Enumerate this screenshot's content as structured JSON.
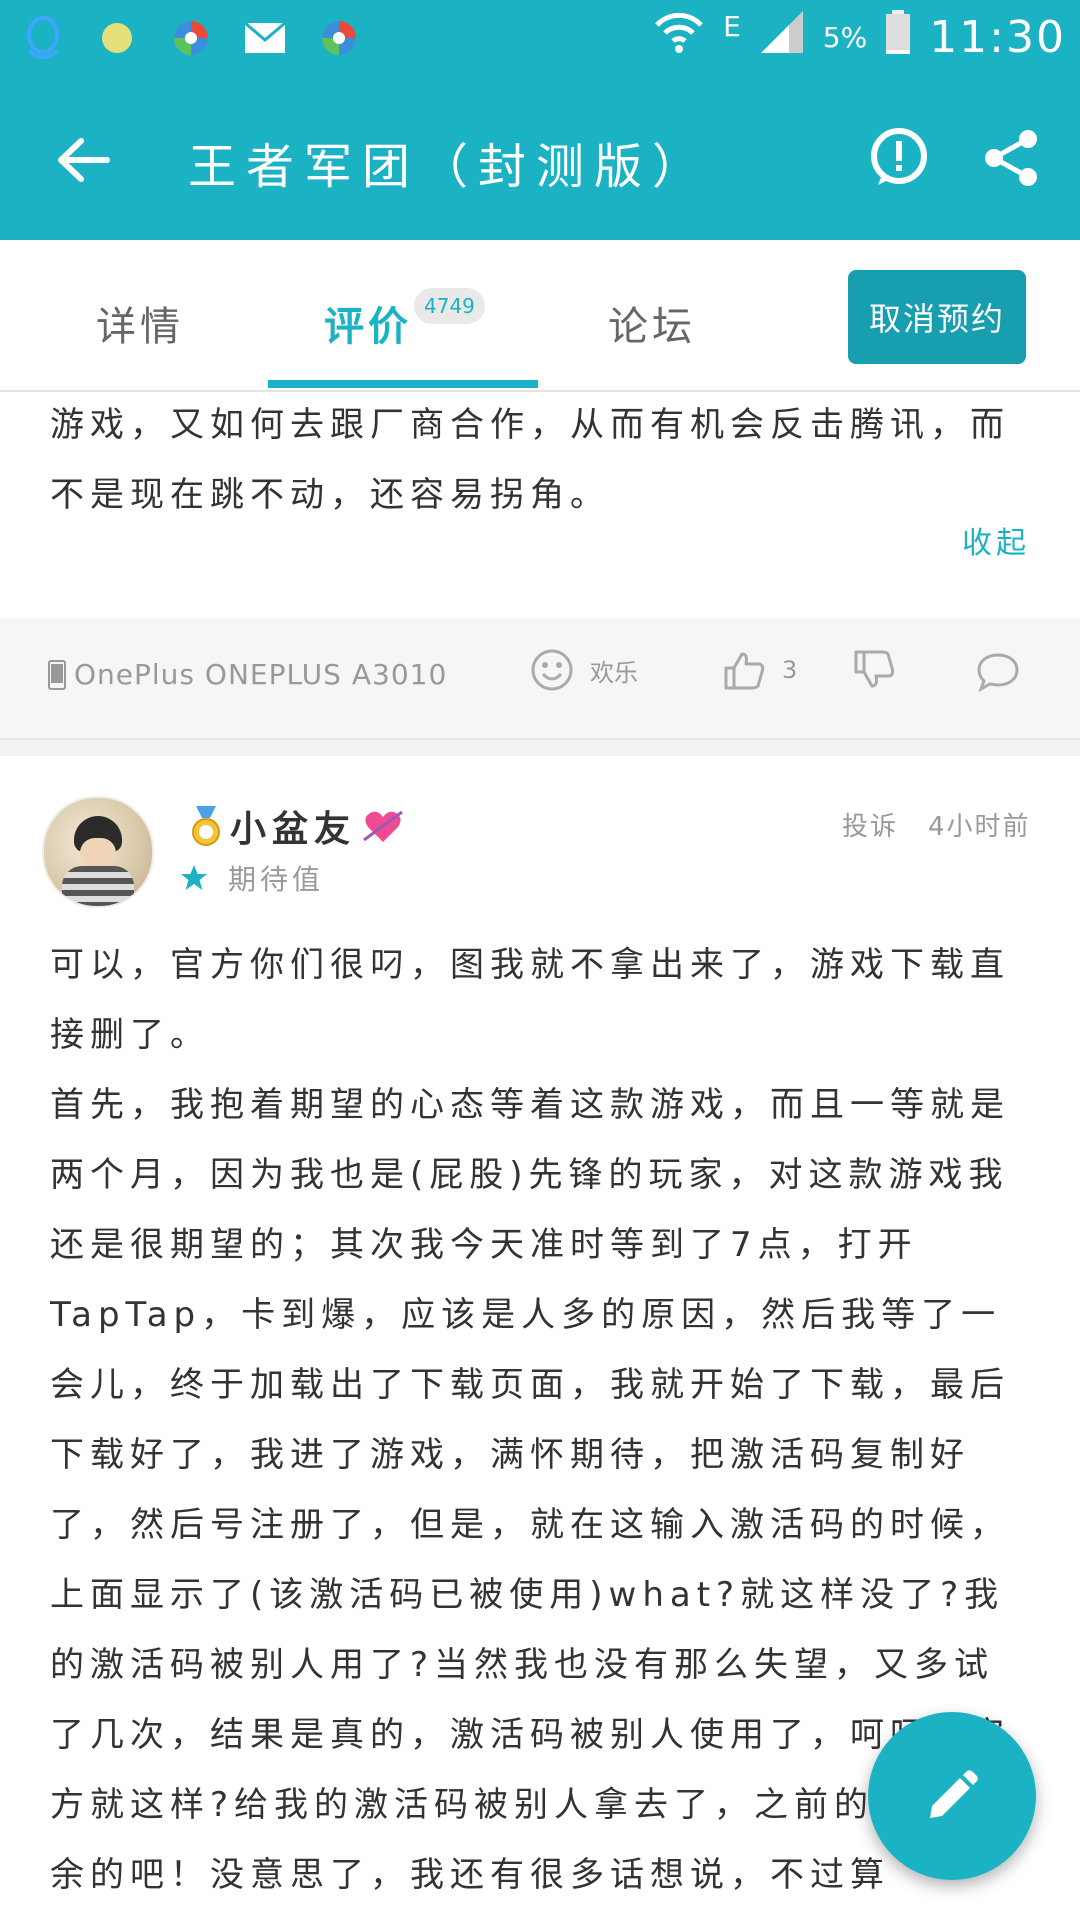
{
  "status_bar": {
    "network": "E",
    "battery_percent": "5%",
    "time": "11:30"
  },
  "app_bar": {
    "title": "王者军团（封测版）"
  },
  "tabs": {
    "detail": "详情",
    "review": "评价",
    "review_count": "4749",
    "forum": "论坛",
    "active": "评价"
  },
  "cancel_reservation": "取消预约",
  "previous_review": {
    "text_tail": "游戏，又如何去跟厂商合作，从而有机会反击腾讯，而不是现在跳不动，还容易拐角。",
    "collapse": "收起",
    "device": "OnePlus ONEPLUS A3010",
    "reaction": "欢乐",
    "likes": "3"
  },
  "review": {
    "username": "小盆友",
    "expectation_label": "期待值",
    "report": "投诉",
    "time": "4小时前",
    "text": "可以，官方你们很叼，图我就不拿出来了，游戏下载直接删了。\n首先，我抱着期望的心态等着这款游戏，而且一等就是两个月，因为我也是(屁股)先锋的玩家，对这款游戏我还是很期望的；其次我今天准时等到了7点，打开TapTap，卡到爆，应该是人多的原因，然后我等了一会儿，终于加载出了下载页面，我就开始了下载，最后下载好了，我进了游戏，满怀期待，把激活码复制好了，然后号注册了，但是，就在这输入激活码的时候，上面显示了(该激活码已被使用)what?就这样没了?我的激活码被别人用了?当然我也没有那么失望，又多试了几次，结果是真的，激活码被别人使用了，呵呵，官方就这样?给我的激活码被别人拿去了，之前的也是多余的吧！没意思了，我还有很多话想说，不过算"
  },
  "colors": {
    "accent": "#1bb2c3",
    "button_dark": "#179fb0"
  },
  "icons": {
    "back": "arrow-left-icon",
    "report": "exclamation-circle-icon",
    "share": "share-icon",
    "edit": "pencil-icon"
  }
}
